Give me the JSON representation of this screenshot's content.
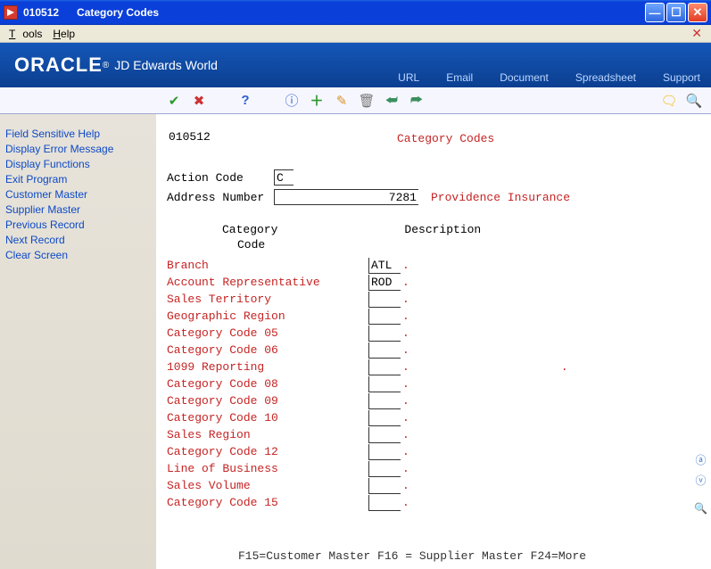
{
  "window": {
    "code": "010512",
    "name": "Category Codes"
  },
  "menu": {
    "tools": "Tools",
    "help": "Help"
  },
  "brand": {
    "logo": "ORACLE",
    "sub": "JD Edwards World"
  },
  "brand_links": {
    "url": "URL",
    "email": "Email",
    "document": "Document",
    "spreadsheet": "Spreadsheet",
    "support": "Support"
  },
  "sidebar": {
    "items": [
      "Field Sensitive Help",
      "Display Error Message",
      "Display Functions",
      "Exit Program",
      "Customer Master",
      "Supplier Master",
      "Previous Record",
      "Next Record",
      "Clear Screen"
    ]
  },
  "main": {
    "program_id": "010512",
    "title": "Category Codes",
    "action_code_label": "Action Code",
    "action_code_value": "C",
    "address_number_label": "Address Number",
    "address_number_value": "7281",
    "address_desc": "Providence Insurance",
    "header_category": "Category",
    "header_code": "Code",
    "header_description": "Description",
    "categories": [
      {
        "label": "Branch",
        "code": "ATL",
        "desc_dot": false
      },
      {
        "label": "Account Representative",
        "code": "ROD",
        "desc_dot": false
      },
      {
        "label": "Sales Territory",
        "code": "",
        "desc_dot": false
      },
      {
        "label": "Geographic Region",
        "code": "",
        "desc_dot": false
      },
      {
        "label": "Category Code 05",
        "code": "",
        "desc_dot": false
      },
      {
        "label": "Category Code 06",
        "code": "",
        "desc_dot": false
      },
      {
        "label": "1099 Reporting",
        "code": "",
        "desc_dot": true
      },
      {
        "label": "Category Code 08",
        "code": "",
        "desc_dot": false
      },
      {
        "label": "Category Code 09",
        "code": "",
        "desc_dot": false
      },
      {
        "label": "Category Code 10",
        "code": "",
        "desc_dot": false
      },
      {
        "label": "Sales Region",
        "code": "",
        "desc_dot": false
      },
      {
        "label": "Category Code 12",
        "code": "",
        "desc_dot": false
      },
      {
        "label": "Line of Business",
        "code": "",
        "desc_dot": false
      },
      {
        "label": "Sales Volume",
        "code": "",
        "desc_dot": false
      },
      {
        "label": "Category Code 15",
        "code": "",
        "desc_dot": false
      }
    ],
    "footer": "F15=Customer Master  F16 = Supplier Master  F24=More"
  }
}
